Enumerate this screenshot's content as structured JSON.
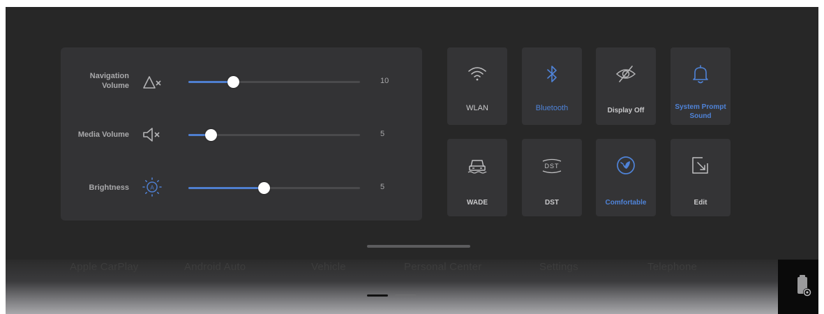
{
  "home": {
    "labels": [
      "Apple CarPlay",
      "Android Auto",
      "Vehicle",
      "Personal Center",
      "Settings",
      "Telephone"
    ]
  },
  "sliders": [
    {
      "label_line1": "Navigation",
      "label_line2": "Volume",
      "icon": "navigation-mute-icon",
      "value": "10",
      "level": 0.26
    },
    {
      "label_line1": "Media Volume",
      "label_line2": "",
      "icon": "speaker-mute-icon",
      "value": "5",
      "level": 0.13
    },
    {
      "label_line1": "Brightness",
      "label_line2": "",
      "icon": "brightness-auto-icon",
      "value": "5",
      "level": 0.44
    }
  ],
  "tiles": [
    {
      "label": "WLAN",
      "icon": "wifi-icon",
      "active": false
    },
    {
      "label": "Bluetooth",
      "icon": "bluetooth-icon",
      "active": true
    },
    {
      "label": "Display Off",
      "icon": "display-off-icon",
      "active": false
    },
    {
      "label": "System Prompt Sound",
      "icon": "bell-icon",
      "active": true
    },
    {
      "label": "WADE",
      "icon": "wade-car-icon",
      "active": false
    },
    {
      "label": "DST",
      "icon": "dst-icon",
      "active": false
    },
    {
      "label": "Comfortable",
      "icon": "drive-mode-comfortable-icon",
      "active": true
    },
    {
      "label": "Edit",
      "icon": "edit-icon",
      "active": false
    }
  ],
  "colors": {
    "accent": "#4f7fd0",
    "panel": "#272727",
    "card": "#333335"
  }
}
